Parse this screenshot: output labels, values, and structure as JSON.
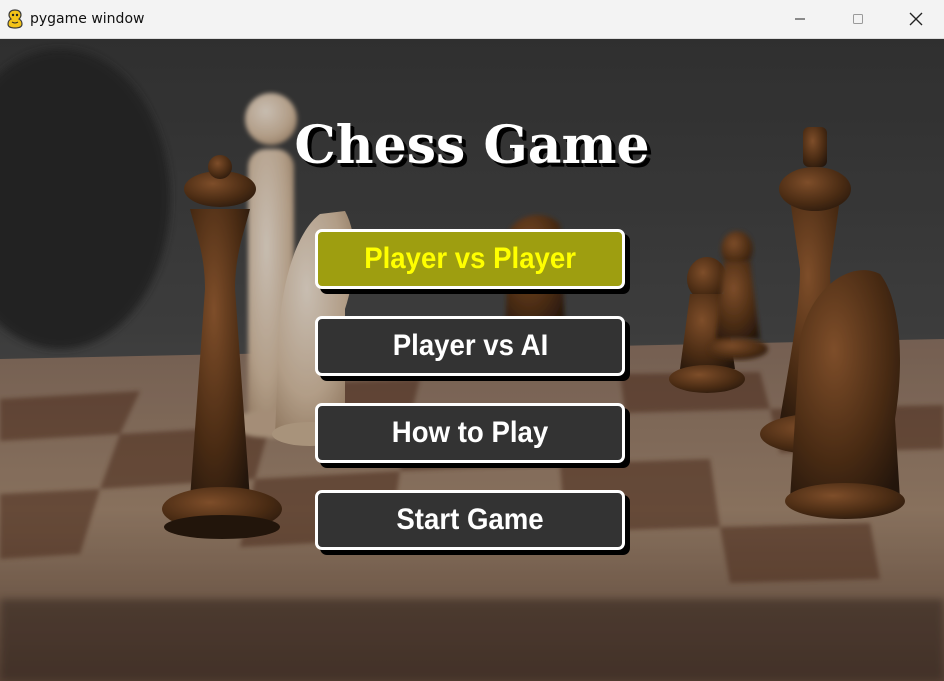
{
  "window": {
    "title": "pygame window",
    "controls": {
      "minimize_icon": "minimize-icon",
      "maximize_icon": "maximize-icon",
      "close_icon": "close-icon"
    }
  },
  "game": {
    "title": "Chess Game",
    "menu": [
      {
        "label": "Player vs Player",
        "selected": true
      },
      {
        "label": "Player vs AI",
        "selected": false
      },
      {
        "label": "How to Play",
        "selected": false
      },
      {
        "label": "Start Game",
        "selected": false
      }
    ],
    "colors": {
      "selected_bg": "#9e9e10",
      "selected_text": "#ffff00",
      "button_bg": "#333333",
      "button_text": "#ffffff",
      "border": "#ffffff"
    }
  }
}
